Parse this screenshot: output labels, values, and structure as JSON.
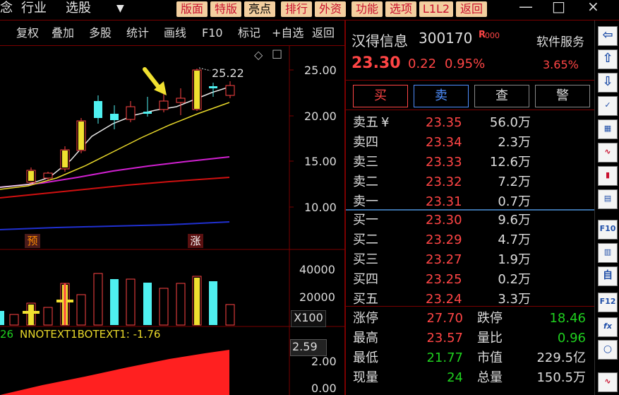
{
  "top_menu": {
    "items": [
      "念",
      "行业",
      "选股"
    ],
    "dropdown_glyph": "▼",
    "buttons": [
      "版面",
      "特版",
      "亮点",
      "排行",
      "外资",
      "功能",
      "选项",
      "L1L2",
      "返回"
    ],
    "window_controls": [
      "—",
      "□",
      "×"
    ]
  },
  "toolbar": {
    "items": [
      "复权",
      "叠加",
      "多股",
      "统计",
      "画线",
      "F10",
      "标记",
      "+自选",
      "返回"
    ]
  },
  "price_chart": {
    "axis_labels": [
      "25.00",
      "20.00",
      "15.00",
      "10.00"
    ],
    "high_label": "25.22",
    "badges": [
      "预",
      "涨"
    ],
    "diamond_glyph": "◇",
    "square_glyph": "□"
  },
  "volume_chart": {
    "axis_labels": [
      "40000",
      "20000"
    ],
    "unit_label": "X100"
  },
  "indicator_chart": {
    "header_prefix": "26",
    "header_text": "NNOTEXT1BOTEXT1: -1.76",
    "axis_labels": [
      "2.59",
      "2.00",
      "0.00"
    ]
  },
  "quote": {
    "name": "汉得信息",
    "code": "300170",
    "tag": "R",
    "tag_suffix": "000",
    "sector": "软件服务",
    "sector_change": "3.65%",
    "price": "23.30",
    "change": "0.22",
    "change_pct": "0.95%",
    "action_buttons": [
      "买",
      "卖",
      "查",
      "警"
    ]
  },
  "order_book": {
    "asks": [
      {
        "label": "卖五",
        "price": "23.35",
        "volume": "56.0万",
        "mark": "¥"
      },
      {
        "label": "卖四",
        "price": "23.34",
        "volume": "2.3万",
        "mark": ""
      },
      {
        "label": "卖三",
        "price": "23.33",
        "volume": "12.6万",
        "mark": ""
      },
      {
        "label": "卖二",
        "price": "23.32",
        "volume": "7.2万",
        "mark": ""
      },
      {
        "label": "卖一",
        "price": "23.31",
        "volume": "0.7万",
        "mark": ""
      }
    ],
    "bids": [
      {
        "label": "买一",
        "price": "23.30",
        "volume": "9.6万"
      },
      {
        "label": "买二",
        "price": "23.29",
        "volume": "4.7万"
      },
      {
        "label": "买三",
        "price": "23.27",
        "volume": "1.9万"
      },
      {
        "label": "买四",
        "price": "23.25",
        "volume": "0.2万"
      },
      {
        "label": "买五",
        "price": "23.24",
        "volume": "3.3万"
      }
    ]
  },
  "stats": [
    {
      "l1": "涨停",
      "v1": "27.70",
      "c1": "red",
      "l2": "跌停",
      "v2": "18.46",
      "c2": "green"
    },
    {
      "l1": "最高",
      "v1": "23.57",
      "c1": "red",
      "l2": "量比",
      "v2": "0.96",
      "c2": "green"
    },
    {
      "l1": "最低",
      "v1": "21.77",
      "c1": "green",
      "l2": "市值",
      "v2": "229.5亿",
      "c2": "white"
    },
    {
      "l1": "现量",
      "v1": "24",
      "c1": "green",
      "l2": "总量",
      "v2": "150.5万",
      "c2": "white"
    }
  ],
  "side_icons": [
    "arrow-left-icon",
    "arrow-up-icon",
    "arrow-down-icon",
    "doc-check-icon",
    "grid-icon",
    "line-chart-icon",
    "candle-icon",
    "list-icon",
    "f10-icon",
    "news-icon",
    "self-icon",
    "f12-icon",
    "fx-icon",
    "circle-icon",
    "chart-small-icon"
  ],
  "side_icon_labels": [
    "⇦",
    "⇧",
    "⇩",
    "✓",
    "▦",
    "∿",
    "▮",
    "▤",
    "F10",
    "▥",
    "自",
    "F12",
    "fx",
    "○",
    "∿"
  ],
  "colors": {
    "up": "#ff4545",
    "down": "#1fd01f",
    "cyan": "#4ff0f0",
    "yellow": "#f0e030",
    "ma_white": "#e8e8e8",
    "ma_yellow": "#e8d82a",
    "ma_magenta": "#d020d0",
    "ma_red": "#d01010",
    "ma_blue": "#2030d0"
  }
}
